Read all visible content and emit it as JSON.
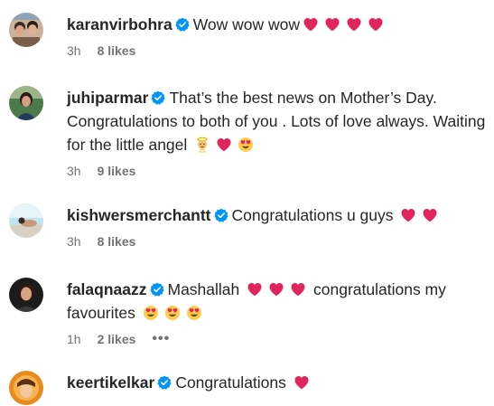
{
  "comments": [
    {
      "username": "karanvirbohra",
      "verified": true,
      "segments": [
        "Wow wow wow"
      ],
      "time": "3h",
      "likes": "8 likes"
    },
    {
      "username": "juhiparmar",
      "verified": true,
      "segments": [
        "That’s the best news on Mother’s Day. Congratulations to both of you . Lots of love always. Waiting for the little angel "
      ],
      "time": "3h",
      "likes": "9 likes"
    },
    {
      "username": "kishwersmerchantt",
      "verified": true,
      "segments": [
        "Congratulations u guys "
      ],
      "time": "3h",
      "likes": "8 likes"
    },
    {
      "username": "falaqnaazz",
      "verified": true,
      "segments": [
        "Mashallah ",
        " congratulations my favourites "
      ],
      "time": "1h",
      "likes": "2 likes",
      "more": "•••"
    },
    {
      "username": "keertikelkar",
      "verified": true,
      "segments": [
        "Congratulations "
      ]
    }
  ],
  "icons": {
    "verified_color": "#0095f6",
    "heart_color": "#e0245e"
  }
}
